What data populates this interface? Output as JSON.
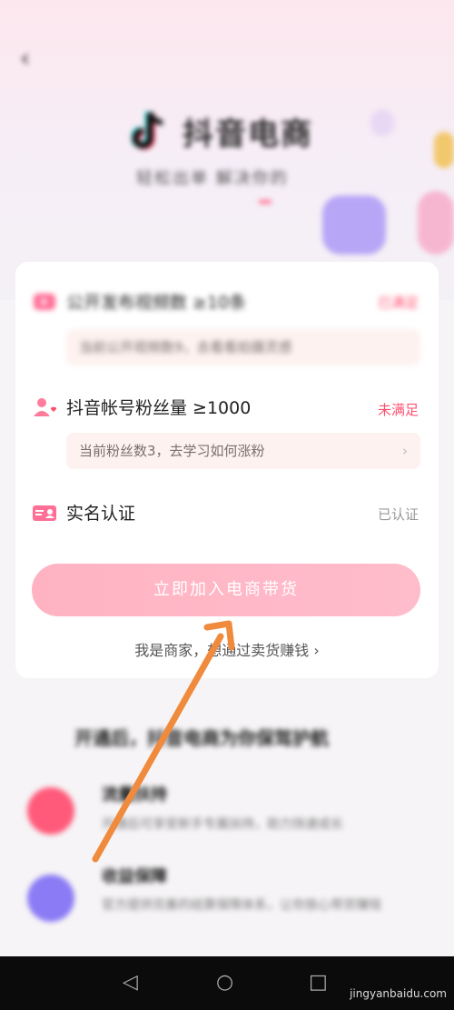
{
  "header": {
    "back_icon": "‹",
    "brand_name": "抖音电商",
    "slogan": "轻松出单 解决你的"
  },
  "requirements": [
    {
      "icon": "video-icon",
      "title": "公开发布视频数 ≥10条",
      "status": "已满足",
      "hint": "当前公开视频数9，去看看拍摄灵感"
    },
    {
      "icon": "fans-icon",
      "title": "抖音帐号粉丝量 ≥1000",
      "status": "未满足",
      "hint": "当前粉丝数3，去学习如何涨粉"
    },
    {
      "icon": "id-card-icon",
      "title": "实名认证",
      "status": "已认证"
    }
  ],
  "join_button": "立即加入电商带货",
  "merchant_link": "我是商家，想通过卖货赚钱 ›",
  "features": {
    "title": "开通后，抖音电商为你保驾护航",
    "items": [
      {
        "title": "流量扶持",
        "desc": "开通后可享受新手专属扶持，助力快速成长"
      },
      {
        "title": "收益保障",
        "desc": "官方提供完善的结算保障体系，让你放心带货赚钱"
      }
    ]
  },
  "watermark": "jingyanbaidu.com",
  "colors": {
    "accent": "#ff4d6d",
    "button": "#ffb7c5",
    "annotation_arrow": "#f08a3c"
  }
}
